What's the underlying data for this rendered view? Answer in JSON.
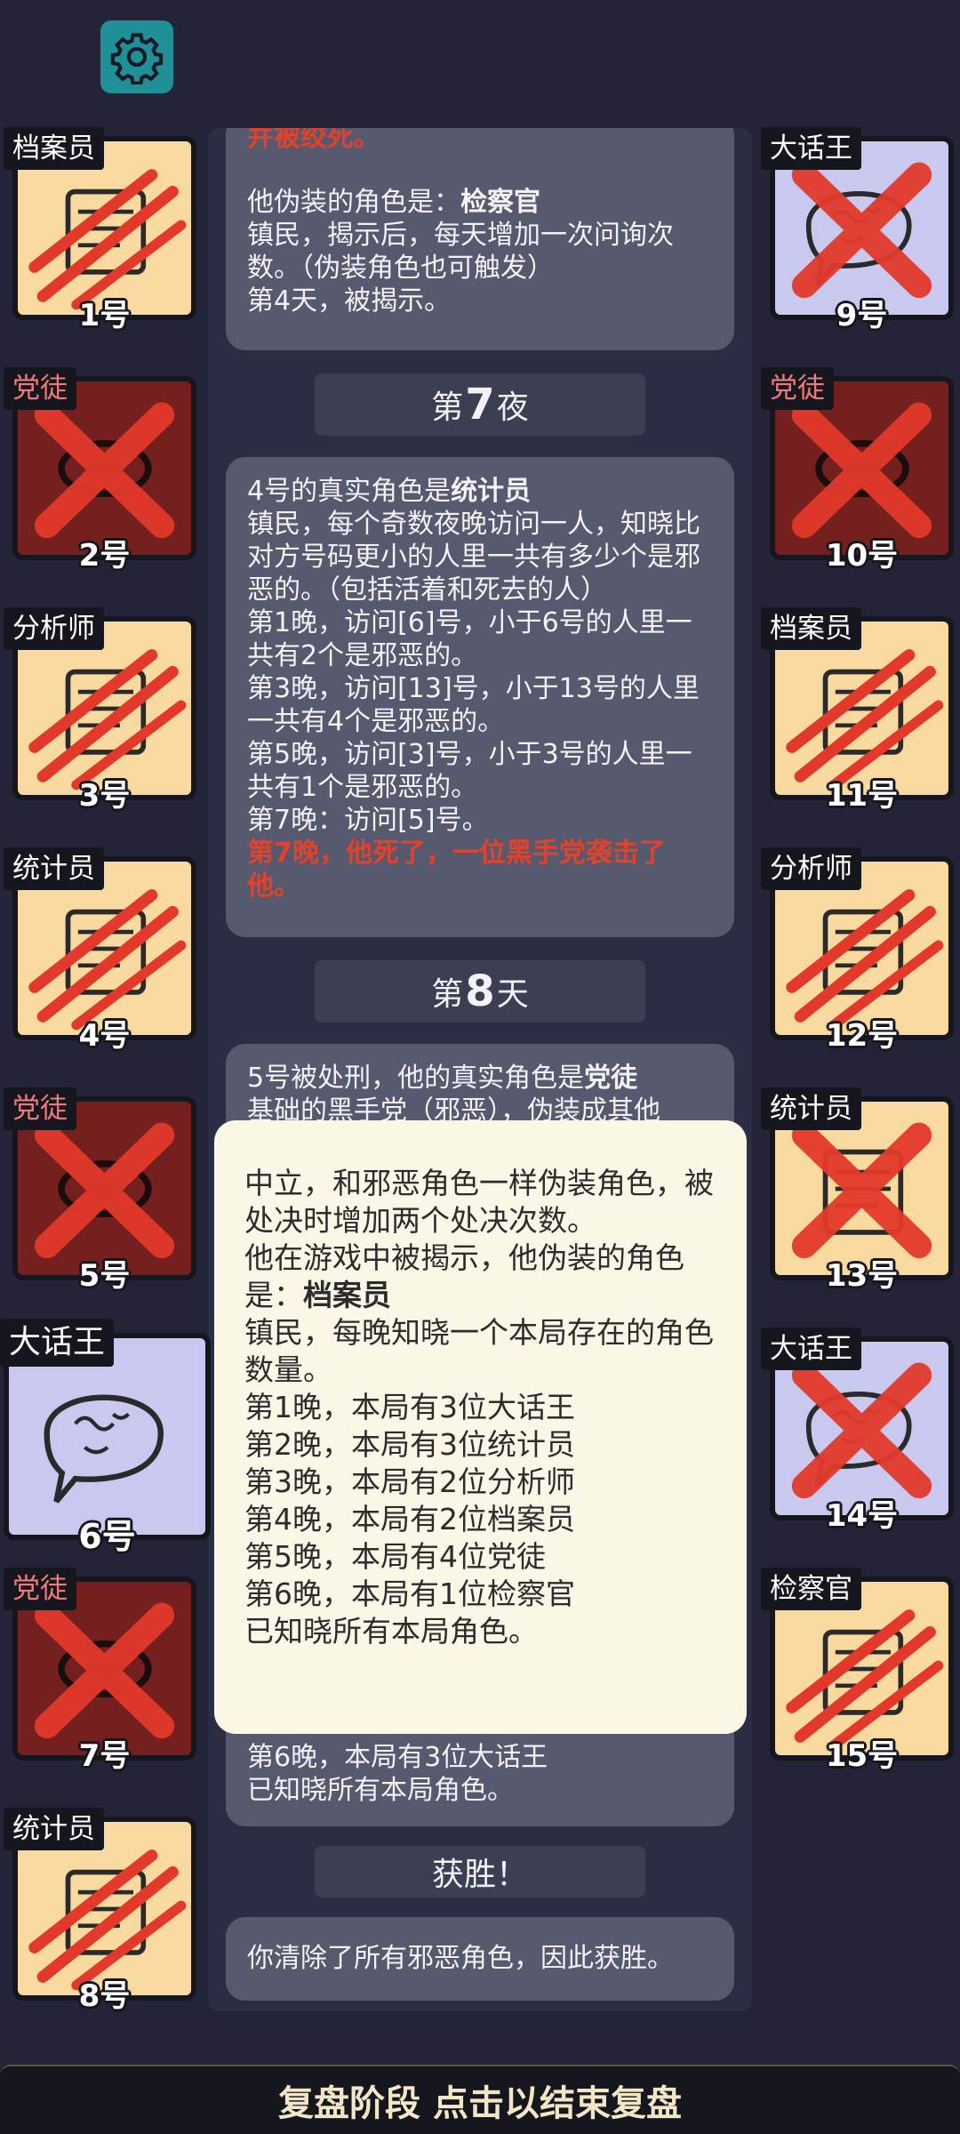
{
  "settings": {
    "icon": "gear-icon"
  },
  "log": {
    "card_top": {
      "partial_red": "并被绞死。",
      "line1_prefix": "他伪装的角色是：",
      "line1_role": "检察官",
      "line2": "镇民，揭示后，每天增加一次问询次数。（伪装角色也可触发）",
      "line3": "第4天，被揭示。"
    },
    "phase_night7": {
      "prefix": "第",
      "number": "7",
      "suffix": "夜"
    },
    "card_night7": {
      "head_prefix": "4号的真实角色是",
      "head_role": "统计员",
      "desc": "镇民，每个奇数夜晚访问一人，知晓比对方号码更小的人里一共有多少个是邪恶的。（包括活着和死去的人）",
      "n1": "第1晚，访问[6]号，小于6号的人里一共有2个是邪恶的。",
      "n3": "第3晚，访问[13]号，小于13号的人里一共有4个是邪恶的。",
      "n5": "第5晚，访问[3]号，小于3号的人里一共有1个是邪恶的。",
      "n7": "第7晚：访问[5]号。",
      "death": "第7晚，他死了，一位黑手党袭击了他。"
    },
    "phase_day8": {
      "prefix": "第",
      "number": "8",
      "suffix": "天"
    },
    "card_day8": {
      "head_prefix": "5号被处刑，他的真实角色是",
      "head_role": "党徒",
      "line2": "基础的黑手党（邪恶），伪装成其他",
      "tail1": "第6晚，本局有3位大话王",
      "tail2": "已知晓所有本局角色。"
    },
    "phase_win": {
      "label": "获胜！"
    },
    "card_win": {
      "text": "你清除了所有邪恶角色，因此获胜。"
    }
  },
  "popup": {
    "line_neutral": "中立，和邪恶角色一样伪装角色，被处决时增加两个处决次数。",
    "line_revealed_prefix": "他在游戏中被揭示，他伪装的角色是：",
    "line_revealed_role": "档案员",
    "line_town": "镇民，每晚知晓一个本局存在的角色数量。",
    "n1": "第1晚，本局有3位大话王",
    "n2": "第2晚，本局有3位统计员",
    "n3": "第3晚，本局有2位分析师",
    "n4": "第4晚，本局有2位档案员",
    "n5": "第5晚，本局有4位党徒",
    "n6": "第6晚，本局有1位检察官",
    "end": "已知晓所有本局角色。"
  },
  "seats_left": [
    {
      "role": "档案员",
      "num": "1号",
      "team": "town",
      "mark": "claw"
    },
    {
      "role": "党徒",
      "num": "2号",
      "team": "evil",
      "mark": "cross"
    },
    {
      "role": "分析师",
      "num": "3号",
      "team": "town",
      "mark": "claw"
    },
    {
      "role": "统计员",
      "num": "4号",
      "team": "town",
      "mark": "claw"
    },
    {
      "role": "党徒",
      "num": "5号",
      "team": "evil",
      "mark": "cross"
    },
    {
      "role": "大话王",
      "num": "6号",
      "team": "liar",
      "mark": "none"
    },
    {
      "role": "党徒",
      "num": "7号",
      "team": "evil",
      "mark": "cross"
    },
    {
      "role": "统计员",
      "num": "8号",
      "team": "town",
      "mark": "claw"
    }
  ],
  "seats_right": [
    {
      "role": "大话王",
      "num": "9号",
      "team": "liar",
      "mark": "cross"
    },
    {
      "role": "党徒",
      "num": "10号",
      "team": "evil",
      "mark": "cross"
    },
    {
      "role": "档案员",
      "num": "11号",
      "team": "town",
      "mark": "claw"
    },
    {
      "role": "分析师",
      "num": "12号",
      "team": "town",
      "mark": "claw"
    },
    {
      "role": "统计员",
      "num": "13号",
      "team": "town",
      "mark": "cross"
    },
    {
      "role": "大话王",
      "num": "14号",
      "team": "liar",
      "mark": "cross"
    },
    {
      "role": "检察官",
      "num": "15号",
      "team": "town",
      "mark": "claw"
    }
  ],
  "bottom_bar": {
    "label": "复盘阶段 点击以结束复盘"
  },
  "colors": {
    "background": "#232438",
    "evil_text": "#e4412a",
    "popup_bg": "#fbf7e7"
  }
}
